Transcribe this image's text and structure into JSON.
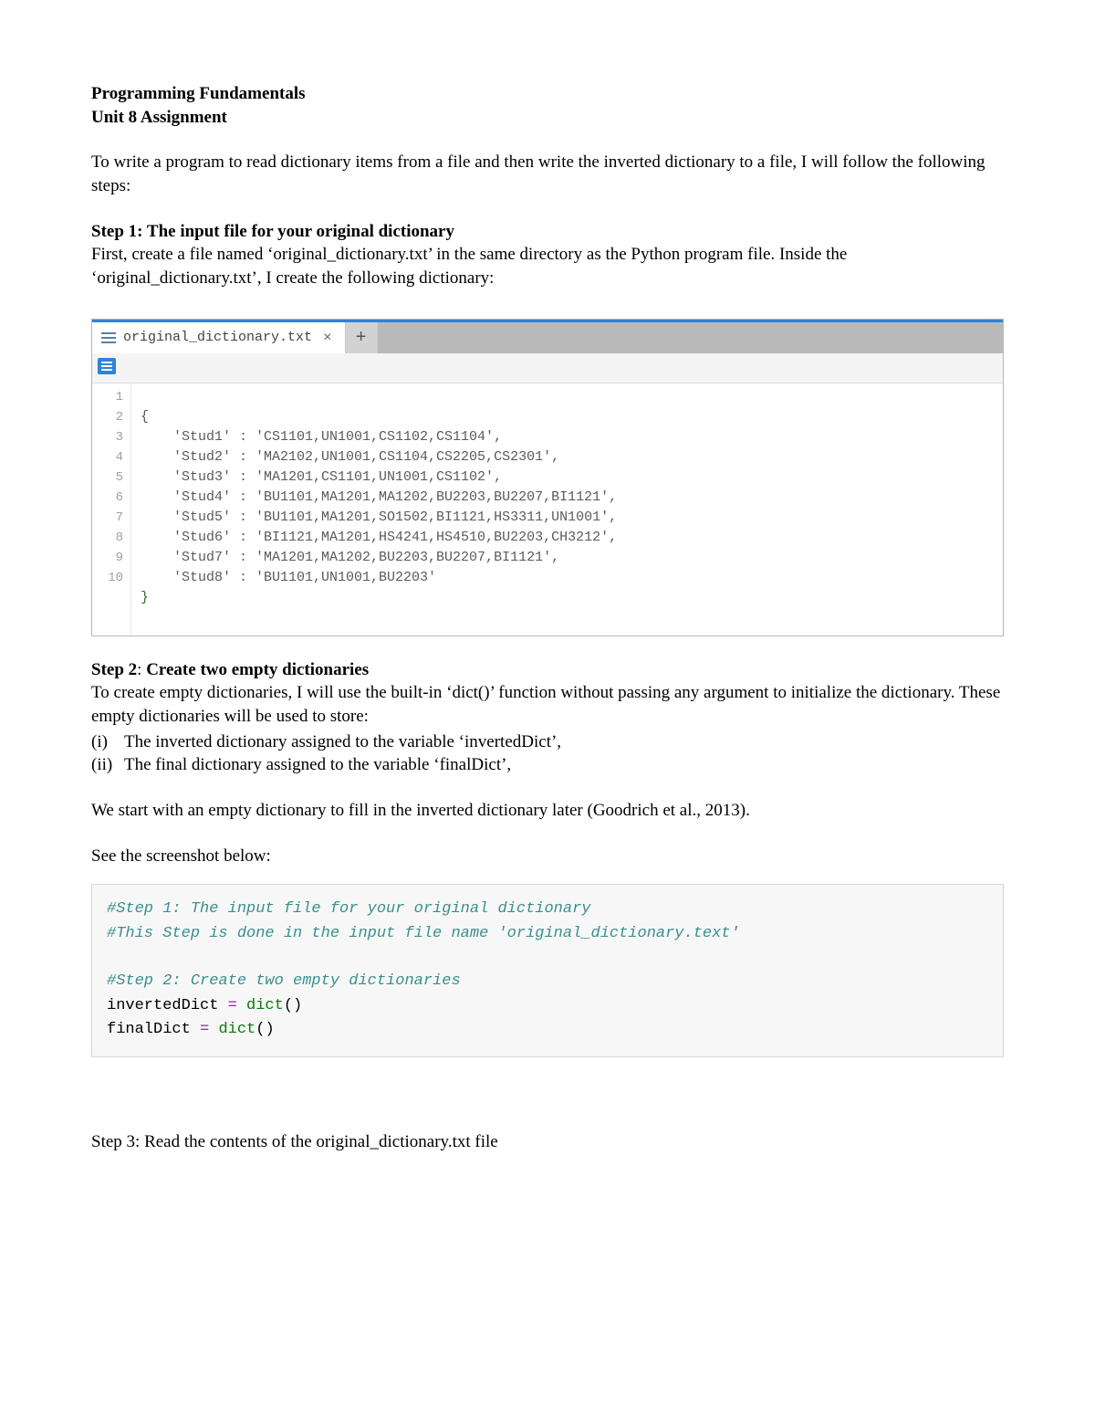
{
  "header": {
    "course": "Programming Fundamentals",
    "unit": "Unit 8 Assignment"
  },
  "intro": "To write a program to read dictionary items from a file and then write the inverted dictionary to a file, I will follow the following steps:",
  "step1": {
    "label": "Step 1:",
    "title": " The input file for your original dictionary",
    "body": "First, create a file named ‘original_dictionary.txt’ in the same directory as the Python program file. Inside the ‘original_dictionary.txt’, I create the following dictionary:"
  },
  "editor": {
    "tab_filename": "original_dictionary.txt",
    "close_symbol": "×",
    "plus_symbol": "+",
    "gutter": [
      "1",
      "2",
      "3",
      "4",
      "5",
      "6",
      "7",
      "8",
      "9",
      "10"
    ],
    "code": {
      "open_brace": "{",
      "lines": [
        "    'Stud1' : 'CS1101,UN1001,CS1102,CS1104',",
        "    'Stud2' : 'MA2102,UN1001,CS1104,CS2205,CS2301',",
        "    'Stud3' : 'MA1201,CS1101,UN1001,CS1102',",
        "    'Stud4' : 'BU1101,MA1201,MA1202,BU2203,BU2207,BI1121',",
        "    'Stud5' : 'BU1101,MA1201,SO1502,BI1121,HS3311,UN1001',",
        "    'Stud6' : 'BI1121,MA1201,HS4241,HS4510,BU2203,CH3212',",
        "    'Stud7' : 'MA1201,MA1202,BU2203,BU2207,BI1121',",
        "    'Stud8' : 'BU1101,UN1001,BU2203'"
      ],
      "close_brace": "}"
    }
  },
  "step2": {
    "label": "Step 2",
    "sep": ": ",
    "title": "Create two empty dictionaries",
    "body": "To create empty dictionaries, I will use the built-in ‘dict()’ function without passing any argument to initialize the dictionary. These empty dictionaries will be used to store:",
    "items": [
      {
        "label": "(i)",
        "text": "The inverted dictionary assigned to the variable ‘invertedDict’,"
      },
      {
        "label": "(ii)",
        "text": "The final dictionary assigned to the variable ‘finalDict’,"
      }
    ],
    "after": "We start with an empty dictionary to fill in the inverted dictionary later (Goodrich et al., 2013).",
    "see_below": "See the screenshot below:"
  },
  "cell": {
    "c1": "#Step 1: The input file for your original dictionary",
    "c2": "#This Step is done in the input file name 'original_dictionary.text'",
    "c3": "#Step 2: Create two empty dictionaries",
    "v1": "invertedDict",
    "v2": "finalDict",
    "eq": " = ",
    "fn": "dict",
    "paren": "()"
  },
  "step3": {
    "label": "Step 3",
    "sep": ": ",
    "title": "Read the contents of the original_dictionary.txt file"
  }
}
